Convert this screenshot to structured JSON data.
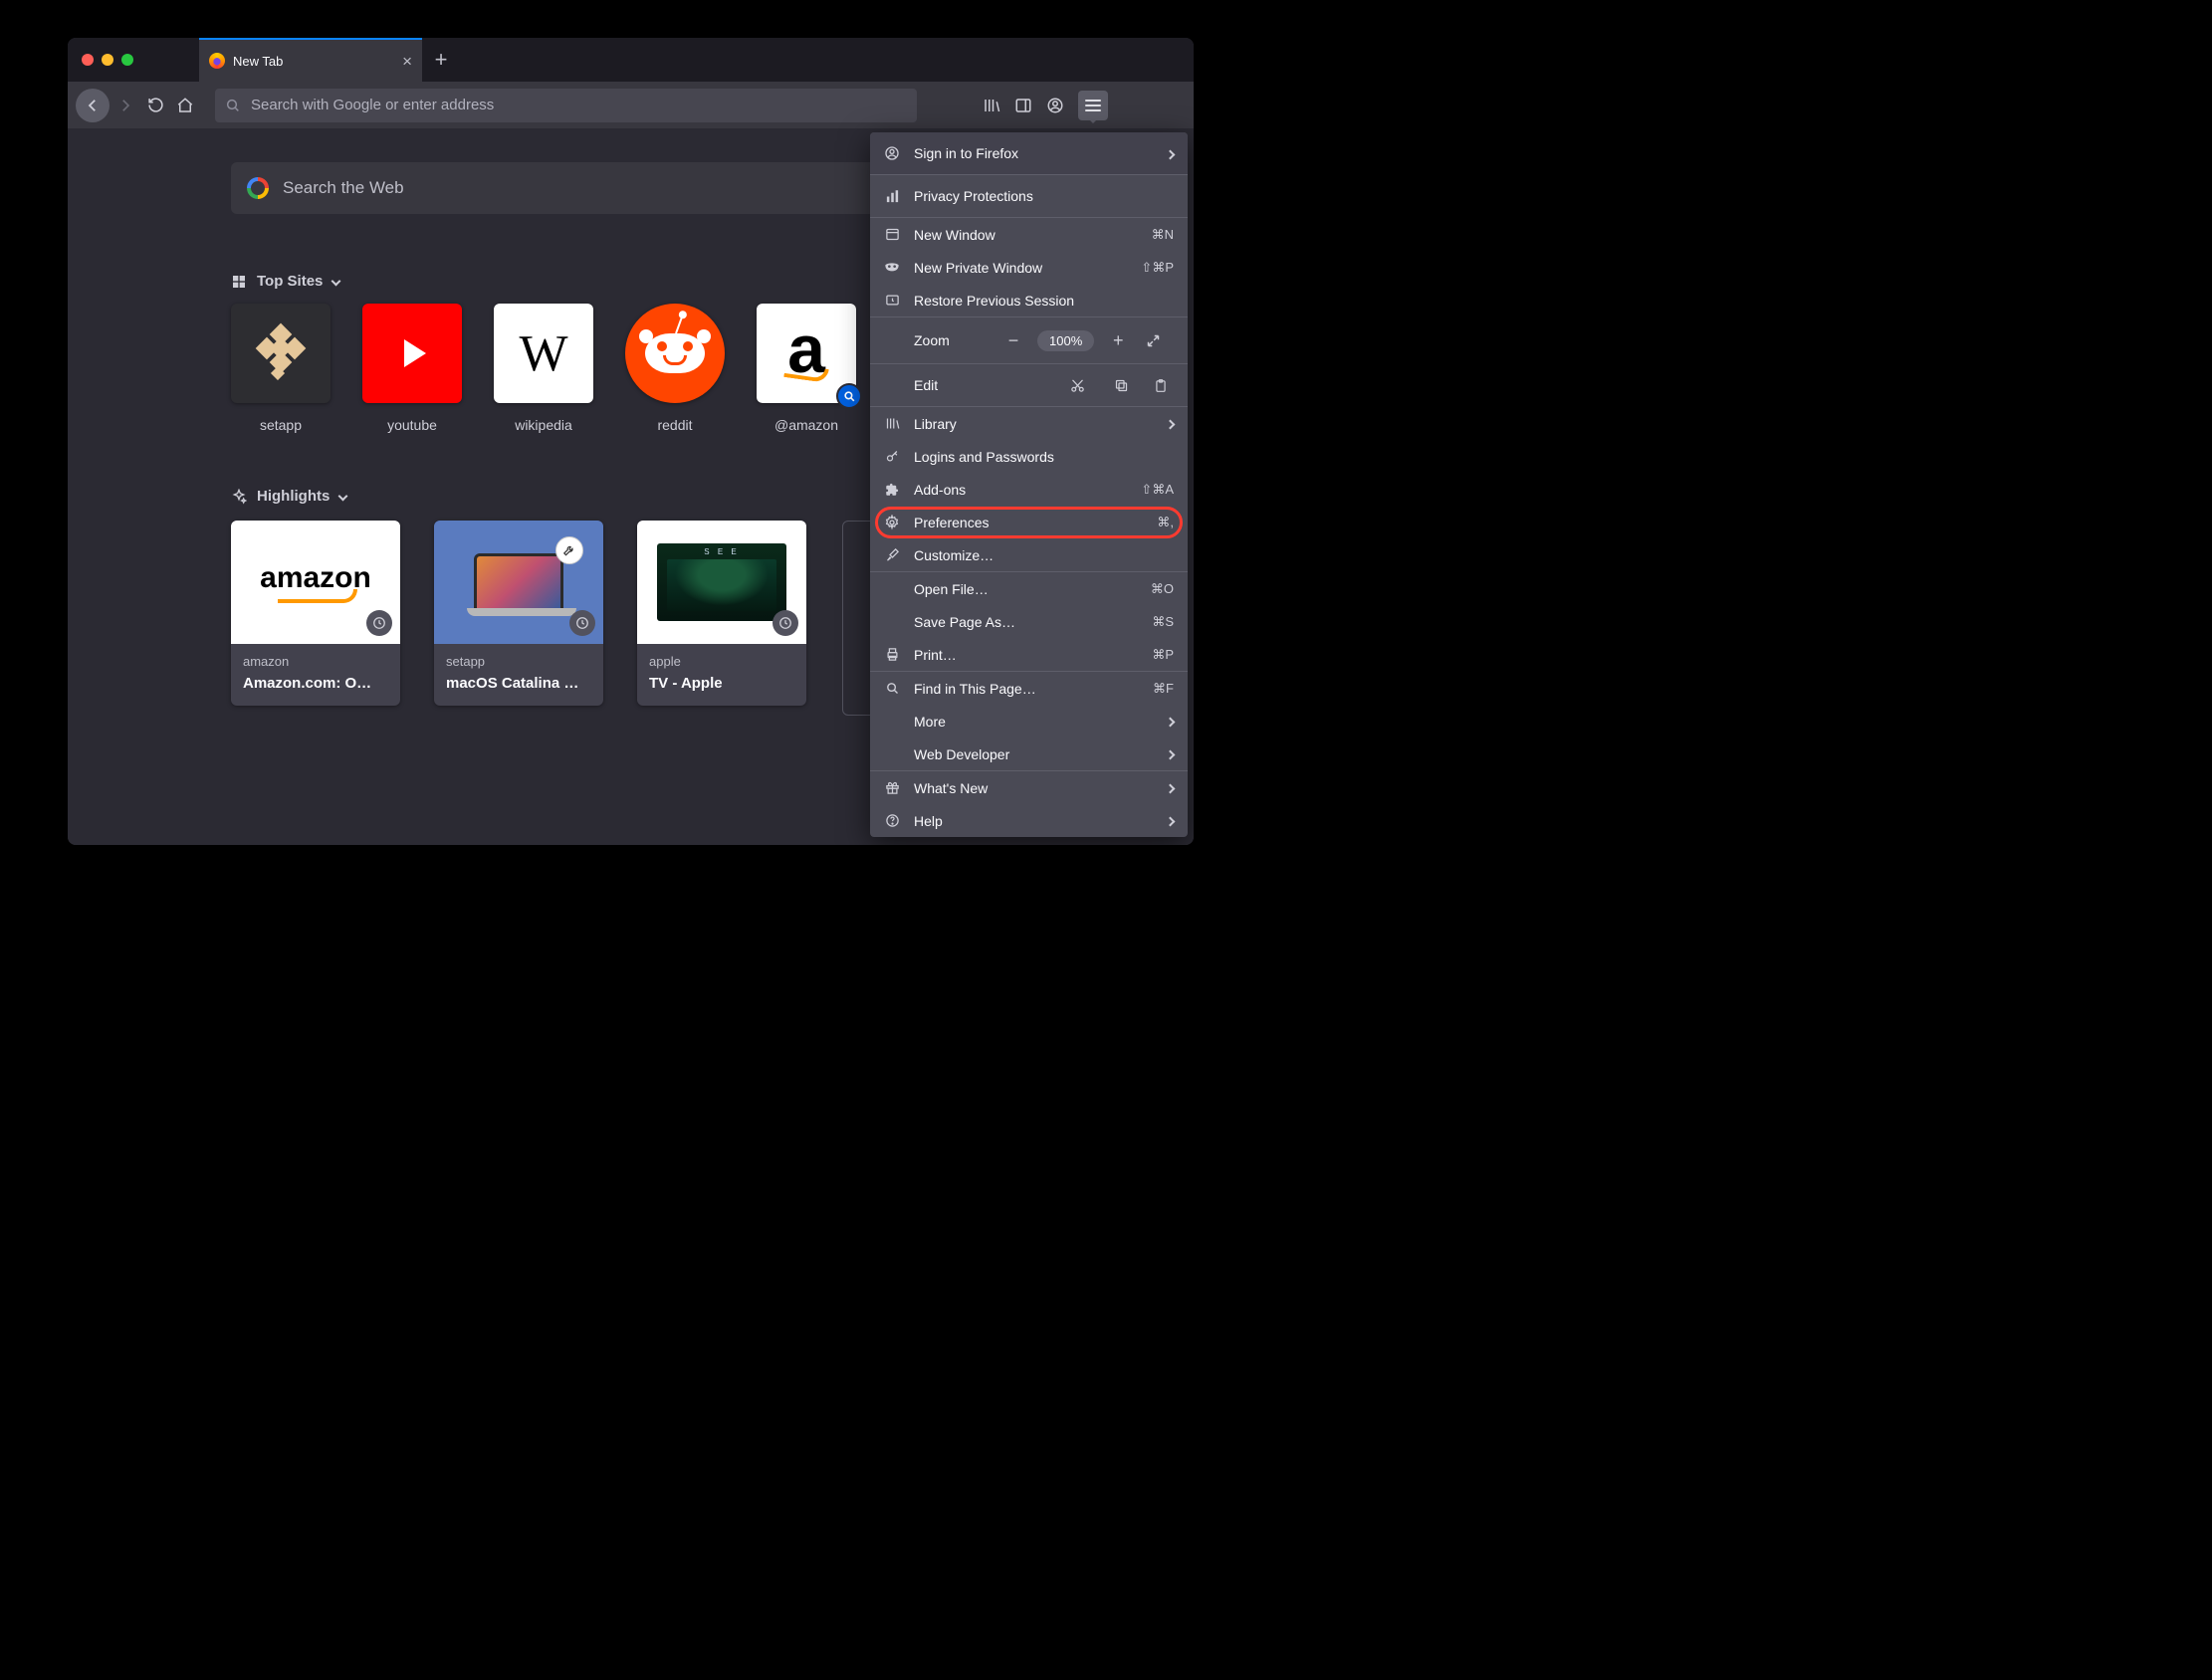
{
  "tab": {
    "title": "New Tab"
  },
  "urlbar": {
    "placeholder": "Search with Google or enter address"
  },
  "search_web": {
    "placeholder": "Search the Web"
  },
  "sections": {
    "top_sites": "Top Sites",
    "highlights": "Highlights"
  },
  "top_sites": [
    {
      "label": "setapp"
    },
    {
      "label": "youtube"
    },
    {
      "label": "wikipedia"
    },
    {
      "label": "reddit"
    },
    {
      "label": "@amazon"
    }
  ],
  "highlights": [
    {
      "sub": "amazon",
      "title": "Amazon.com: O…"
    },
    {
      "sub": "setapp",
      "title": "macOS Catalina …"
    },
    {
      "sub": "apple",
      "title": "TV - Apple"
    }
  ],
  "menu": {
    "sign_in": "Sign in to Firefox",
    "privacy": "Privacy Protections",
    "new_window": {
      "label": "New Window",
      "accel": "⌘N"
    },
    "new_private": {
      "label": "New Private Window",
      "accel": "⇧⌘P"
    },
    "restore": "Restore Previous Session",
    "zoom": {
      "label": "Zoom",
      "value": "100%"
    },
    "edit": "Edit",
    "library": "Library",
    "logins": "Logins and Passwords",
    "addons": {
      "label": "Add-ons",
      "accel": "⇧⌘A"
    },
    "preferences": {
      "label": "Preferences",
      "accel": "⌘,"
    },
    "customize": "Customize…",
    "open_file": {
      "label": "Open File…",
      "accel": "⌘O"
    },
    "save_as": {
      "label": "Save Page As…",
      "accel": "⌘S"
    },
    "print": {
      "label": "Print…",
      "accel": "⌘P"
    },
    "find": {
      "label": "Find in This Page…",
      "accel": "⌘F"
    },
    "more": "More",
    "webdev": "Web Developer",
    "whats_new": "What's New",
    "help": "Help"
  }
}
